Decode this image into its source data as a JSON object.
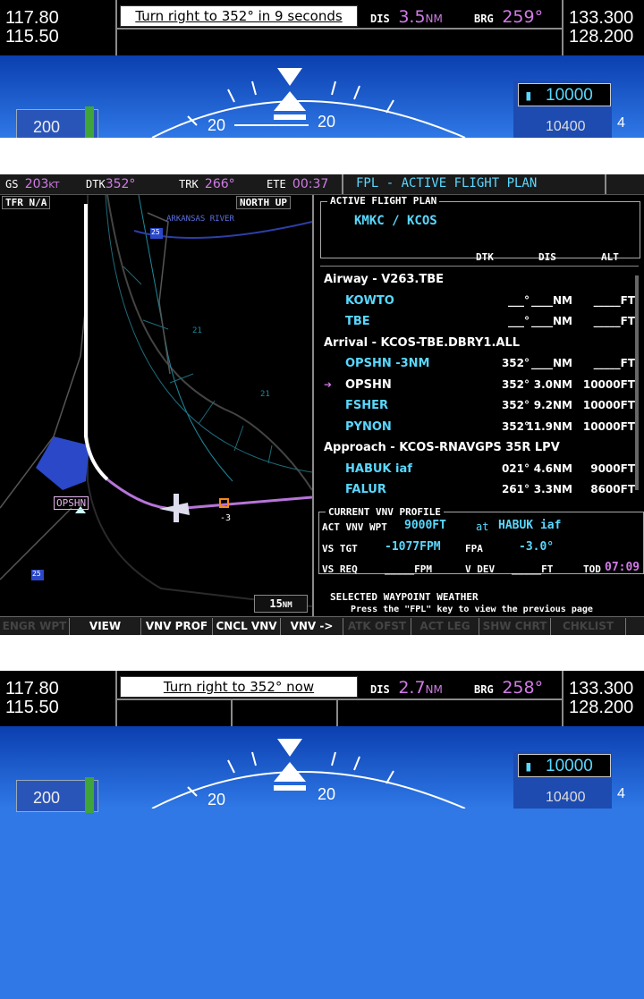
{
  "pfd_top": {
    "nav_active": "117.80",
    "nav_standby": "115.50",
    "message": "Turn right to 352° in 9 seconds",
    "dis_label": "DIS",
    "dis_value": "3.5",
    "dis_unit": "NM",
    "brg_label": "BRG",
    "brg_value": "259°",
    "com_active": "133.300",
    "com_standby": "128.200",
    "altitude_bug": "10000",
    "alt_tape_partial": "10400",
    "alt_tape_next": "4",
    "airspeed": "200",
    "pitch_left": "20",
    "pitch_right": "20"
  },
  "mfd": {
    "databar": {
      "gs_label": "GS",
      "gs_value": "203",
      "gs_unit": "KT",
      "dtk_label": "DTK",
      "dtk_value": "352°",
      "trk_label": "TRK",
      "trk_value": "266°",
      "ete_label": "ETE",
      "ete_value": "00:37",
      "page_title": "FPL - ACTIVE FLIGHT PLAN"
    },
    "map": {
      "tfr": "TFR N/A",
      "orientation": "NORTH UP",
      "river": "ARKANSAS RIVER",
      "hwy1": "25",
      "hwy2": "25",
      "waypoint": "OPSHN",
      "range": "15",
      "range_unit": "NM",
      "grid1": "21",
      "grid2": "21",
      "vs_marker": "-3"
    },
    "fpl": {
      "section_title": "ACTIVE FLIGHT PLAN",
      "route": "KMKC / KCOS",
      "col_dtk": "DTK",
      "col_dis": "DIS",
      "col_alt": "ALT",
      "rows": [
        {
          "name": "Airway - V263.TBE",
          "dtk": "",
          "dis": "",
          "alt": "",
          "kind": "header"
        },
        {
          "name": "KOWTO",
          "dtk": "___°",
          "dis": "____NM",
          "alt": "_____FT",
          "kind": "wpt"
        },
        {
          "name": "TBE",
          "dtk": "___°",
          "dis": "____NM",
          "alt": "_____FT",
          "kind": "wpt"
        },
        {
          "name": "Arrival - KCOS-TBE.DBRY1.ALL",
          "dtk": "",
          "dis": "",
          "alt": "",
          "kind": "header"
        },
        {
          "name": "OPSHN -3NM",
          "dtk": "352°",
          "dis": "____NM",
          "alt": "_____FT",
          "kind": "wpt"
        },
        {
          "name": "OPSHN",
          "dtk": "352°",
          "dis": "3.0NM",
          "alt": "10000FT",
          "kind": "active"
        },
        {
          "name": "FSHER",
          "dtk": "352°",
          "dis": "9.2NM",
          "alt": "10000FT",
          "kind": "wpt"
        },
        {
          "name": "PYNON",
          "dtk": "352°",
          "dis": "11.9NM",
          "alt": "10000FT",
          "kind": "wpt"
        },
        {
          "name": "Approach - KCOS-RNAVGPS 35R LPV",
          "dtk": "",
          "dis": "",
          "alt": "",
          "kind": "header"
        },
        {
          "name": "HABUK iaf",
          "dtk": "021°",
          "dis": "4.6NM",
          "alt": "9000FT",
          "kind": "wpt"
        },
        {
          "name": "FALUR",
          "dtk": "261°",
          "dis": "3.3NM",
          "alt": "8600FT",
          "kind": "wpt"
        }
      ],
      "vnv_title": "CURRENT VNV PROFILE",
      "act_vnv_label": "ACT VNV WPT",
      "act_vnv_alt": "9000FT",
      "act_vnv_at": "at",
      "act_vnv_wpt": "HABUK iaf",
      "vs_tgt_label": "VS TGT",
      "vs_tgt": "-1077FPM",
      "fpa_label": "FPA",
      "fpa": "-3.0°",
      "vs_req_label": "VS REQ",
      "vs_req": "_____FPM",
      "vdev_label": "V DEV",
      "vdev": "_____FT",
      "tod_label": "TOD",
      "tod": "07:09",
      "wx_title": "SELECTED WAYPOINT WEATHER",
      "hint": "Press the \"FPL\" key to view the previous page"
    },
    "softkeys": [
      {
        "label": "ENGR WPT",
        "on": false
      },
      {
        "label": "VIEW",
        "on": true
      },
      {
        "label": "VNV PROF",
        "on": true
      },
      {
        "label": "CNCL VNV",
        "on": true
      },
      {
        "label": "VNV ->",
        "on": true
      },
      {
        "label": "ATK OFST",
        "on": false
      },
      {
        "label": "ACT LEG",
        "on": false
      },
      {
        "label": "SHW CHRT",
        "on": false
      },
      {
        "label": "CHKLIST",
        "on": false
      }
    ]
  },
  "pfd_bottom": {
    "nav_active": "117.80",
    "nav_standby": "115.50",
    "message": "Turn right to 352° now",
    "dis_label": "DIS",
    "dis_value": "2.7",
    "dis_unit": "NM",
    "brg_label": "BRG",
    "brg_value": "258°",
    "com_active": "133.300",
    "com_standby": "128.200",
    "altitude_bug": "10000",
    "alt_tape_partial": "10400",
    "alt_tape_next": "4",
    "airspeed": "200",
    "pitch_left": "20",
    "pitch_right": "20"
  },
  "colors": {
    "magenta": "#d17be6",
    "cyan": "#59d8ff",
    "sky": "#2f78e6"
  }
}
